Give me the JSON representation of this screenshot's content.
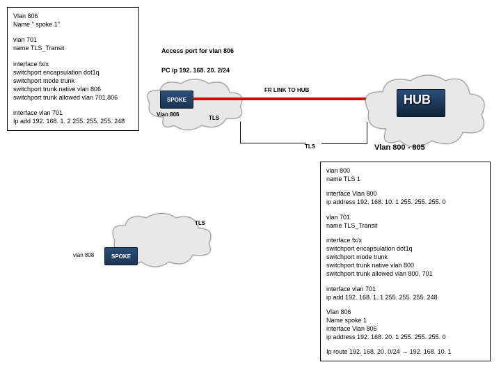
{
  "leftConfig": {
    "block1_l1": "Vlan 806",
    "block1_l2": "Name \" spoke 1\"",
    "block2_l1": "vlan 701",
    "block2_l2": "name TLS_Transit",
    "block3_l1": "interface fx/x",
    "block3_l2": "switchport encapsulation dot1q",
    "block3_l3": "switchport mode trunk",
    "block3_l4": "switchport trunk native vlan 806",
    "block3_l5": "switchport trunk allowed vlan 701,806",
    "block4_l1": "interface vlan 701",
    "block4_l2": "Ip add 192. 168. 1. 2 255. 255. 255. 248"
  },
  "rightConfig": {
    "l1": "vlan 800",
    "l2": "name TLS 1",
    "l3": "interface Vlan 800",
    "l4": "ip address 192. 168. 10. 1 255. 255. 255. 0",
    "l5": "vlan 701",
    "l6": "name TLS_Transit",
    "l7": "interface fx/x",
    "l8": "switchport encapsulation dot1q",
    "l9": "switchport mode trunk",
    "l10": "switchport trunk native vlan 800",
    "l11": "switchport trunk allowed vlan 800, 701",
    "l12": "interface vlan 701",
    "l13": "ip add 192. 168. 1. 1 255. 255. 255. 248",
    "l14": "Vlan 806",
    "l15": "Name spoke 1",
    "l16": "interface Vlan 806",
    "l17": "ip address 192. 168. 20. 1 255. 255. 255. 0",
    "l18": "Ip route 192. 168. 20. 0/24 → 192. 168. 10. 1"
  },
  "labels": {
    "access_port": "Access port for vlan 806",
    "pc_ip": "PC ip 192. 168. 20. 2/24",
    "fr_link": "FR LINK TO HUB",
    "vlan806": "Vlan 806",
    "tls": "TLS",
    "vlan_range": "Vlan 800 - 805",
    "vlan808": "vlan 808",
    "spoke": "SPOKE",
    "hub": "HUB"
  }
}
